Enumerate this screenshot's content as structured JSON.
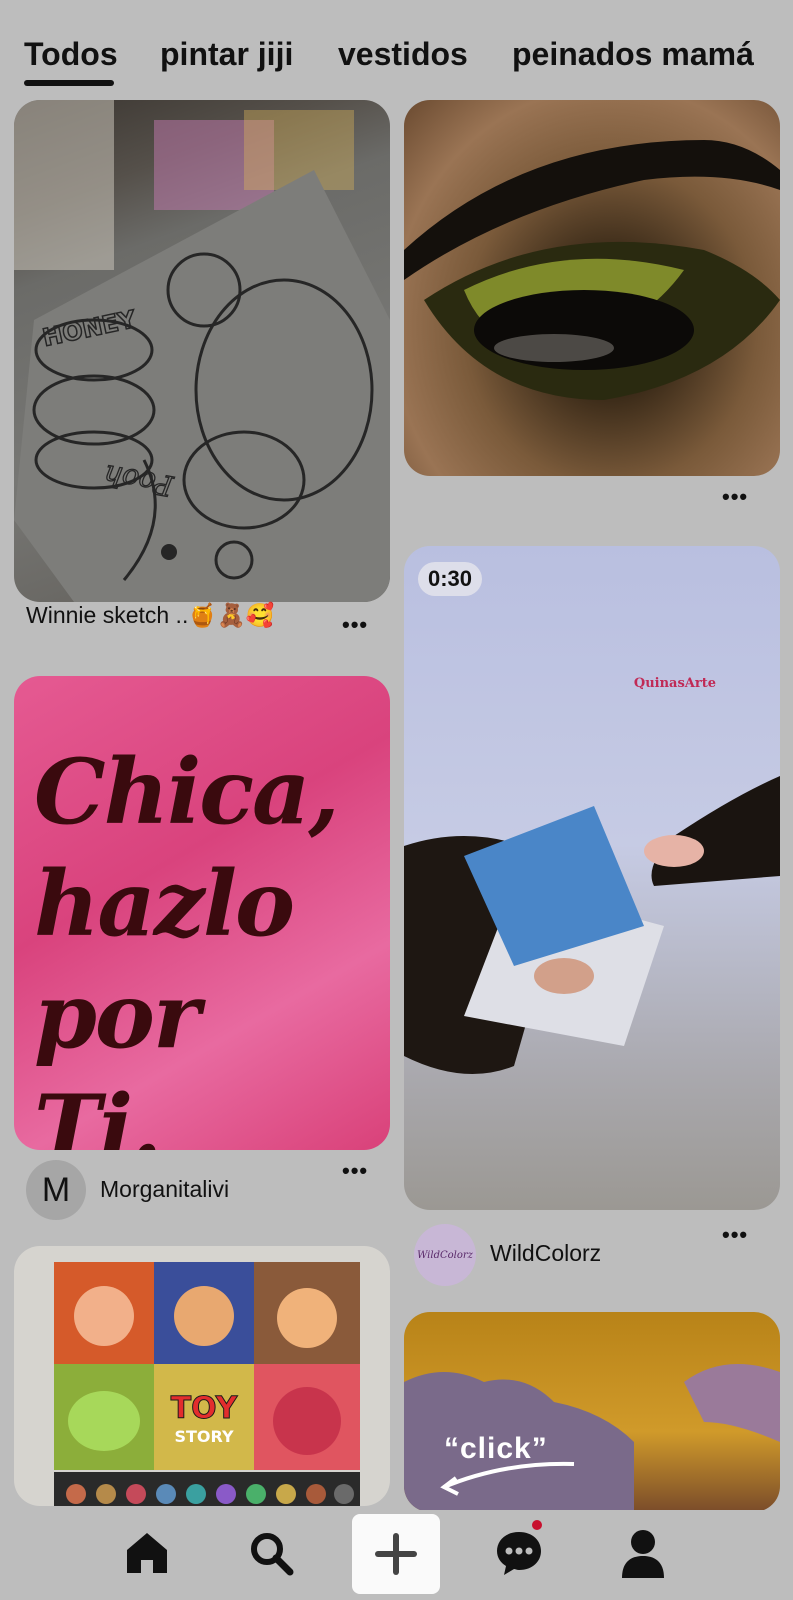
{
  "tabs": [
    {
      "label": "Todos"
    },
    {
      "label": "pintar jiji"
    },
    {
      "label": "vestidos"
    },
    {
      "label": "peinados mamá"
    }
  ],
  "pins": {
    "sketch": {
      "caption": "Winnie sketch ..🍯🧸🥰",
      "sketch_text": "Pooh",
      "jar_text": "HONEY"
    },
    "chica": {
      "text": "Chica,\nhazlo por\nTi."
    },
    "chica_author": {
      "initial": "M",
      "name": "Morganitalivi"
    },
    "video": {
      "duration": "0:30",
      "watermark": "QuinasArte"
    },
    "video_author": {
      "avatar_text": "WildColorz",
      "name": "WildColorz"
    },
    "toy": {
      "logo_line1": "TOY",
      "logo_line2": "STORY"
    },
    "sunset": {
      "overlay": "“click”"
    }
  },
  "more_glyph": "•••",
  "nav": {
    "items": [
      "home-icon",
      "search-icon",
      "plus-icon",
      "chat-icon",
      "profile-icon"
    ],
    "has_notification": true
  },
  "colors": {
    "background": "#bdbdbd",
    "text": "#111111",
    "notification": "#c8102e"
  }
}
